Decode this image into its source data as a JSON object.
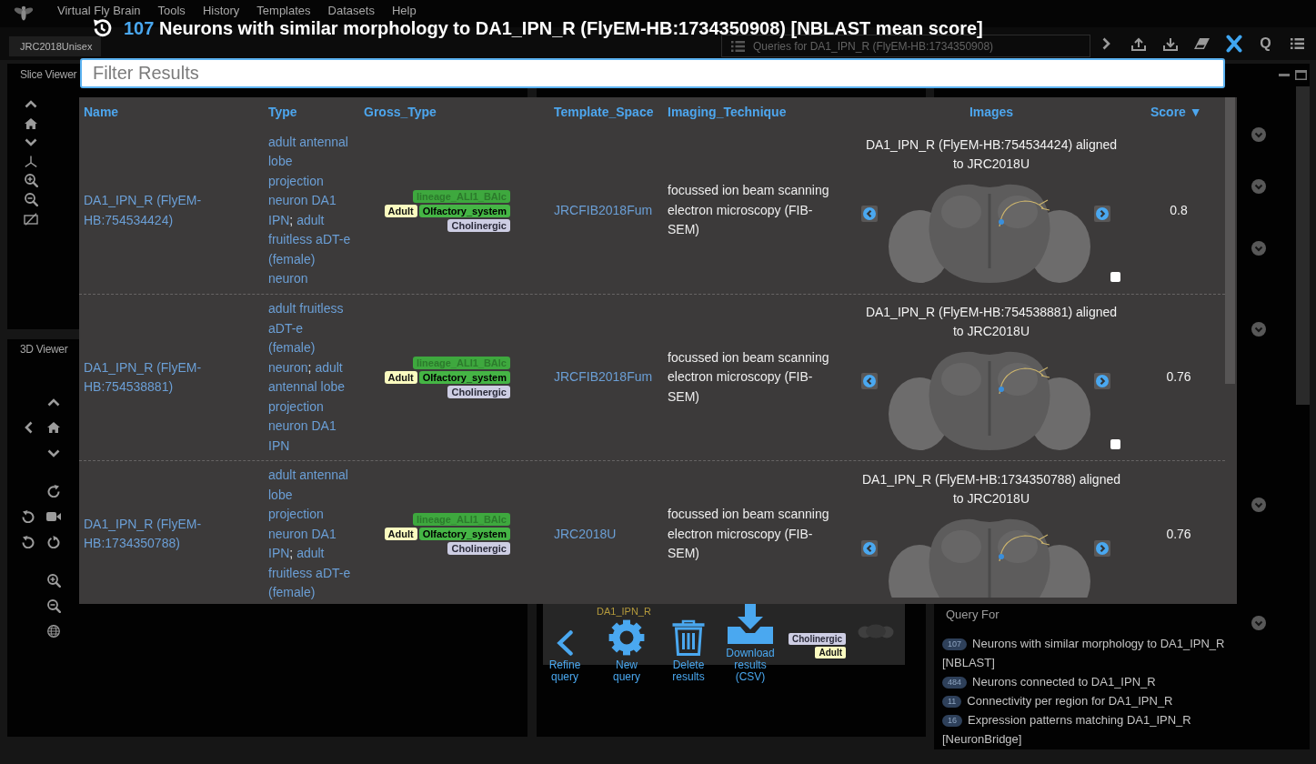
{
  "menu_bar": {
    "app_title": "Virtual Fly Brain",
    "items": [
      "Tools",
      "History",
      "Templates",
      "Datasets",
      "Help"
    ]
  },
  "toolbar": {
    "template_tab": "JRC2018Unisex",
    "queries_box": "Queries for DA1_IPN_R (FlyEM-HB:1734350908)",
    "quick_search": "Q"
  },
  "slice_viewer": {
    "title": "Slice Viewer"
  },
  "viewer_3d": {
    "title": "3D Viewer"
  },
  "term_card": {
    "name": "DA1_IPN_R",
    "tags": [
      {
        "label": "Cholinergic",
        "kind": "transmitter",
        "color": "#cdcde3"
      },
      {
        "label": "Adult",
        "kind": "stage",
        "color": "#fbfbc0"
      }
    ]
  },
  "query_for": {
    "title": "Query For",
    "queries": [
      {
        "count": "107",
        "label": "Neurons with similar morphology to DA1_IPN_R [NBLAST]"
      },
      {
        "count": "484",
        "label": "Neurons connected to DA1_IPN_R"
      },
      {
        "count": "11",
        "label": "Connectivity per region for DA1_IPN_R"
      },
      {
        "count": "16",
        "label": "Expression patterns matching DA1_IPN_R [NeuronBridge]"
      }
    ]
  },
  "results_dialog": {
    "count": "107",
    "title": "Neurons with similar morphology to DA1_IPN_R (FlyEM-HB:1734350908) [NBLAST mean score]",
    "filter": {
      "placeholder": "Filter Results"
    },
    "table": {
      "columns": [
        "Name",
        "Type",
        "Gross_Type",
        "Template_Space",
        "Imaging_Technique",
        "Images",
        "Score ▼"
      ],
      "type_separator": ";",
      "rows": [
        {
          "name": "DA1_IPN_R (FlyEM-HB:754534424)",
          "types": [
            "adult antennal lobe projection neuron DA1 IPN",
            "adult fruitless aDT-e (female) neuron"
          ],
          "tags": [
            {
              "label": "lineage_ALI1_BAlc",
              "kind": "lineage",
              "color": "#3ea83e"
            },
            {
              "label": "Adult",
              "kind": "stage",
              "color": "#fbfbc0"
            },
            {
              "label": "Olfactory_system",
              "kind": "system",
              "color": "#45b545"
            },
            {
              "label": "Cholinergic",
              "kind": "transmitter",
              "color": "#cdcde3"
            }
          ],
          "template_space": "JRCFIB2018Fum",
          "imaging_technique": "focussed ion beam scanning electron microscopy (FIB-SEM)",
          "image_caption": "DA1_IPN_R (FlyEM-HB:754534424) aligned to JRC2018U",
          "checked": false,
          "score": "0.8"
        },
        {
          "name": "DA1_IPN_R (FlyEM-HB:754538881)",
          "types": [
            "adult fruitless aDT-e (female) neuron",
            "adult antennal lobe projection neuron DA1 IPN"
          ],
          "tags": [
            {
              "label": "lineage_ALI1_BAlc",
              "kind": "lineage",
              "color": "#3ea83e"
            },
            {
              "label": "Adult",
              "kind": "stage",
              "color": "#fbfbc0"
            },
            {
              "label": "Olfactory_system",
              "kind": "system",
              "color": "#45b545"
            },
            {
              "label": "Cholinergic",
              "kind": "transmitter",
              "color": "#cdcde3"
            }
          ],
          "template_space": "JRCFIB2018Fum",
          "imaging_technique": "focussed ion beam scanning electron microscopy (FIB-SEM)",
          "image_caption": "DA1_IPN_R (FlyEM-HB:754538881) aligned to JRC2018U",
          "checked": false,
          "score": "0.76"
        },
        {
          "name": "DA1_IPN_R (FlyEM-HB:1734350788)",
          "types": [
            "adult antennal lobe projection neuron DA1 IPN",
            "adult fruitless aDT-e (female)"
          ],
          "tags": [
            {
              "label": "lineage_ALI1_BAlc",
              "kind": "lineage",
              "color": "#3ea83e"
            },
            {
              "label": "Adult",
              "kind": "stage",
              "color": "#fbfbc0"
            },
            {
              "label": "Olfactory_system",
              "kind": "system",
              "color": "#45b545"
            },
            {
              "label": "Cholinergic",
              "kind": "transmitter",
              "color": "#cdcde3"
            }
          ],
          "template_space": "JRC2018U",
          "imaging_technique": "focussed ion beam scanning electron microscopy (FIB-SEM)",
          "image_caption": "DA1_IPN_R (FlyEM-HB:1734350788) aligned to JRC2018U",
          "score": "0.76"
        }
      ]
    },
    "actions": [
      {
        "label": "Refine query",
        "kind": "refine"
      },
      {
        "label": "New query",
        "kind": "new"
      },
      {
        "label": "Delete results",
        "kind": "delete"
      },
      {
        "label": "Download results (CSV)",
        "kind": "download"
      }
    ]
  }
}
